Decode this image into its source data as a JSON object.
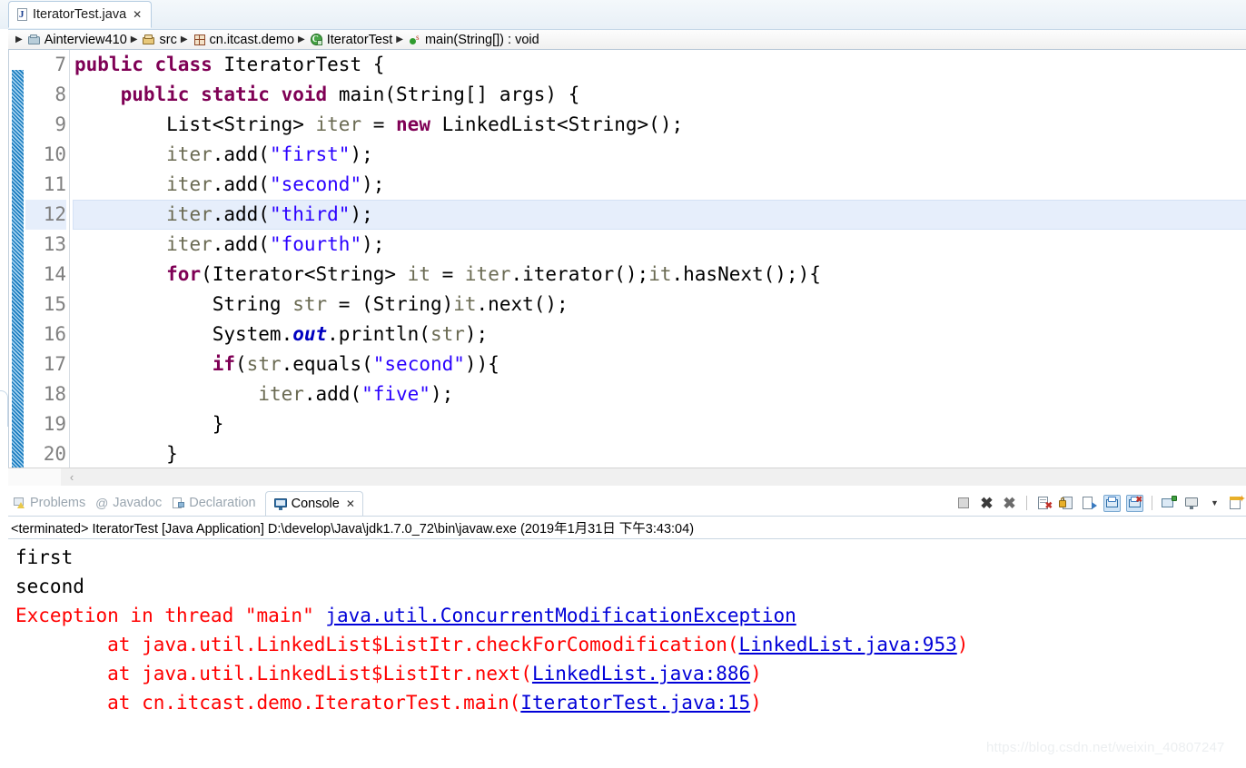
{
  "window": {
    "watermark": "https://blog.csdn.net/weixin_40807247"
  },
  "editor_tab": {
    "label": "IteratorTest.java",
    "close": "✕",
    "icon": "java-file-icon",
    "icon_letter": "J"
  },
  "breadcrumb": {
    "separator": "▶",
    "items": [
      {
        "label": "Ainterview410",
        "icon": "project-folder-icon"
      },
      {
        "label": "src",
        "icon": "source-folder-icon"
      },
      {
        "label": "cn.itcast.demo",
        "icon": "package-icon"
      },
      {
        "label": "IteratorTest",
        "icon": "java-class-icon",
        "icon_letter": "C"
      },
      {
        "label": "main(String[]) : void",
        "icon": "method-icon",
        "icon_badge": "s"
      }
    ]
  },
  "code": {
    "current_line": 12,
    "lines": [
      {
        "number": "7",
        "tokens": [
          {
            "t": "public",
            "c": "kw"
          },
          {
            "t": " ",
            "c": "plain"
          },
          {
            "t": "class",
            "c": "kw"
          },
          {
            "t": " IteratorTest {",
            "c": "plain"
          }
        ]
      },
      {
        "number": "8",
        "tokens": [
          {
            "t": "    ",
            "c": "plain"
          },
          {
            "t": "public",
            "c": "kw"
          },
          {
            "t": " ",
            "c": "plain"
          },
          {
            "t": "static",
            "c": "kw"
          },
          {
            "t": " ",
            "c": "plain"
          },
          {
            "t": "void",
            "c": "kw"
          },
          {
            "t": " main(String[] args) {",
            "c": "plain"
          }
        ]
      },
      {
        "number": "9",
        "tokens": [
          {
            "t": "        List<String> ",
            "c": "plain"
          },
          {
            "t": "iter",
            "c": "var"
          },
          {
            "t": " = ",
            "c": "plain"
          },
          {
            "t": "new",
            "c": "kw"
          },
          {
            "t": " LinkedList<String>();",
            "c": "plain"
          }
        ]
      },
      {
        "number": "10",
        "tokens": [
          {
            "t": "        ",
            "c": "plain"
          },
          {
            "t": "iter",
            "c": "var"
          },
          {
            "t": ".add(",
            "c": "plain"
          },
          {
            "t": "\"first\"",
            "c": "str"
          },
          {
            "t": ");",
            "c": "plain"
          }
        ]
      },
      {
        "number": "11",
        "tokens": [
          {
            "t": "        ",
            "c": "plain"
          },
          {
            "t": "iter",
            "c": "var"
          },
          {
            "t": ".add(",
            "c": "plain"
          },
          {
            "t": "\"second\"",
            "c": "str"
          },
          {
            "t": ");",
            "c": "plain"
          }
        ]
      },
      {
        "number": "12",
        "tokens": [
          {
            "t": "        ",
            "c": "plain"
          },
          {
            "t": "iter",
            "c": "var"
          },
          {
            "t": ".add(",
            "c": "plain"
          },
          {
            "t": "\"third\"",
            "c": "str"
          },
          {
            "t": ");",
            "c": "plain"
          }
        ]
      },
      {
        "number": "13",
        "tokens": [
          {
            "t": "        ",
            "c": "plain"
          },
          {
            "t": "iter",
            "c": "var"
          },
          {
            "t": ".add(",
            "c": "plain"
          },
          {
            "t": "\"fourth\"",
            "c": "str"
          },
          {
            "t": ");",
            "c": "plain"
          }
        ]
      },
      {
        "number": "14",
        "tokens": [
          {
            "t": "        ",
            "c": "plain"
          },
          {
            "t": "for",
            "c": "kw"
          },
          {
            "t": "(Iterator<String> ",
            "c": "plain"
          },
          {
            "t": "it",
            "c": "var"
          },
          {
            "t": " = ",
            "c": "plain"
          },
          {
            "t": "iter",
            "c": "var"
          },
          {
            "t": ".iterator();",
            "c": "plain"
          },
          {
            "t": "it",
            "c": "var"
          },
          {
            "t": ".hasNext();){",
            "c": "plain"
          }
        ]
      },
      {
        "number": "15",
        "tokens": [
          {
            "t": "            String ",
            "c": "plain"
          },
          {
            "t": "str",
            "c": "var"
          },
          {
            "t": " = (String)",
            "c": "plain"
          },
          {
            "t": "it",
            "c": "var"
          },
          {
            "t": ".next();",
            "c": "plain"
          }
        ]
      },
      {
        "number": "16",
        "tokens": [
          {
            "t": "            System.",
            "c": "plain"
          },
          {
            "t": "out",
            "c": "fld"
          },
          {
            "t": ".println(",
            "c": "plain"
          },
          {
            "t": "str",
            "c": "var"
          },
          {
            "t": ");",
            "c": "plain"
          }
        ]
      },
      {
        "number": "17",
        "tokens": [
          {
            "t": "            ",
            "c": "plain"
          },
          {
            "t": "if",
            "c": "kw"
          },
          {
            "t": "(",
            "c": "plain"
          },
          {
            "t": "str",
            "c": "var"
          },
          {
            "t": ".equals(",
            "c": "plain"
          },
          {
            "t": "\"second\"",
            "c": "str"
          },
          {
            "t": ")){",
            "c": "plain"
          }
        ]
      },
      {
        "number": "18",
        "tokens": [
          {
            "t": "                ",
            "c": "plain"
          },
          {
            "t": "iter",
            "c": "var"
          },
          {
            "t": ".add(",
            "c": "plain"
          },
          {
            "t": "\"five\"",
            "c": "str"
          },
          {
            "t": ");",
            "c": "plain"
          }
        ]
      },
      {
        "number": "19",
        "tokens": [
          {
            "t": "            }",
            "c": "plain"
          }
        ]
      },
      {
        "number": "20",
        "tokens": [
          {
            "t": "        }",
            "c": "plain"
          }
        ]
      }
    ]
  },
  "editor_scroll": {
    "left_arrow": "‹"
  },
  "bottom_view": {
    "tabs": [
      {
        "label": "Problems",
        "icon": "problems-icon",
        "active": false
      },
      {
        "label": "Javadoc",
        "icon": "javadoc-icon",
        "active": false
      },
      {
        "label": "Declaration",
        "icon": "declaration-icon",
        "active": false
      },
      {
        "label": "Console",
        "icon": "console-icon",
        "active": true,
        "close": "✕"
      }
    ],
    "toolbar": [
      {
        "name": "terminate-button",
        "kind": "stop",
        "toggled": false
      },
      {
        "name": "remove-launch-button",
        "kind": "x",
        "glyph": "✖",
        "toggled": false
      },
      {
        "name": "remove-all-terminated-button",
        "kind": "xx",
        "glyph": "✖",
        "toggled": false
      },
      {
        "name": "separator-1",
        "kind": "sep"
      },
      {
        "name": "clear-console-button",
        "kind": "clear",
        "toggled": false
      },
      {
        "name": "scroll-lock-button",
        "kind": "lock",
        "toggled": false
      },
      {
        "name": "word-wrap-button",
        "kind": "scroll",
        "toggled": false
      },
      {
        "name": "show-console-on-output-button",
        "kind": "display",
        "toggled": true
      },
      {
        "name": "show-console-on-error-button",
        "kind": "display-error",
        "toggled": true
      },
      {
        "name": "separator-2",
        "kind": "sep"
      },
      {
        "name": "pin-console-button",
        "kind": "pin",
        "toggled": false
      },
      {
        "name": "display-selected-console-button",
        "kind": "monitor",
        "toggled": false
      },
      {
        "name": "console-dropdown-button",
        "kind": "caret",
        "glyph": "▼",
        "toggled": false
      },
      {
        "name": "open-console-button",
        "kind": "new",
        "toggled": false
      }
    ],
    "terminated_line": "<terminated> IteratorTest [Java Application] D:\\develop\\Java\\jdk1.7.0_72\\bin\\javaw.exe (2019年1月31日 下午3:43:04)",
    "output": [
      {
        "segments": [
          {
            "t": "first",
            "c": "out"
          }
        ]
      },
      {
        "segments": [
          {
            "t": "second",
            "c": "out"
          }
        ]
      },
      {
        "segments": [
          {
            "t": "Exception in thread \"main\" ",
            "c": "err"
          },
          {
            "t": "java.util.ConcurrentModificationException",
            "c": "lnk"
          }
        ]
      },
      {
        "segments": [
          {
            "t": "\tat java.util.LinkedList$ListItr.checkForComodification(",
            "c": "err"
          },
          {
            "t": "LinkedList.java:953",
            "c": "lnk"
          },
          {
            "t": ")",
            "c": "err"
          }
        ]
      },
      {
        "segments": [
          {
            "t": "\tat java.util.LinkedList$ListItr.next(",
            "c": "err"
          },
          {
            "t": "LinkedList.java:886",
            "c": "lnk"
          },
          {
            "t": ")",
            "c": "err"
          }
        ]
      },
      {
        "segments": [
          {
            "t": "\tat cn.itcast.demo.IteratorTest.main(",
            "c": "err"
          },
          {
            "t": "IteratorTest.java:15",
            "c": "lnk"
          },
          {
            "t": ")",
            "c": "err"
          }
        ]
      }
    ]
  }
}
